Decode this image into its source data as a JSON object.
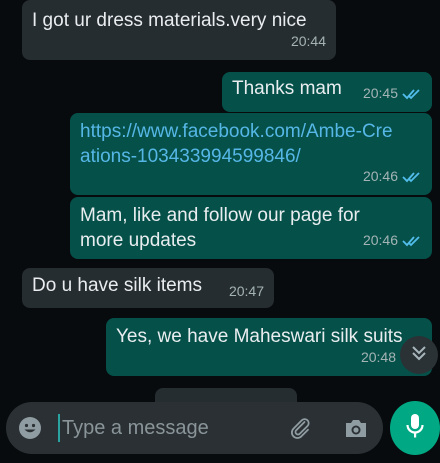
{
  "messages": [
    {
      "text": "I got  ur dress materials.very nice",
      "time": "20:44"
    },
    {
      "text": "Thanks mam",
      "time": "20:45"
    },
    {
      "text": "https://www.facebook.com/Ambe-Creations-103433994599846/",
      "time": "20:46"
    },
    {
      "text": "Mam, like and follow our page for more updates",
      "time": "20:46"
    },
    {
      "text": "Do u have silk items",
      "time": "20:47"
    },
    {
      "text": "Yes, we have Maheswari silk suits",
      "time": "20:48"
    }
  ],
  "composer": {
    "placeholder": "Type a message"
  },
  "icons": {
    "emoji": "emoji-icon",
    "attach": "paperclip-icon",
    "camera": "camera-icon",
    "mic": "microphone-icon",
    "scroll": "chevron-double-down-icon",
    "read": "double-check-icon"
  },
  "colors": {
    "incoming_bubble": "#262d31",
    "outgoing_bubble": "#05514a",
    "link": "#56b7e6",
    "read_tick": "#53bdeb",
    "mic_button": "#00a884"
  }
}
